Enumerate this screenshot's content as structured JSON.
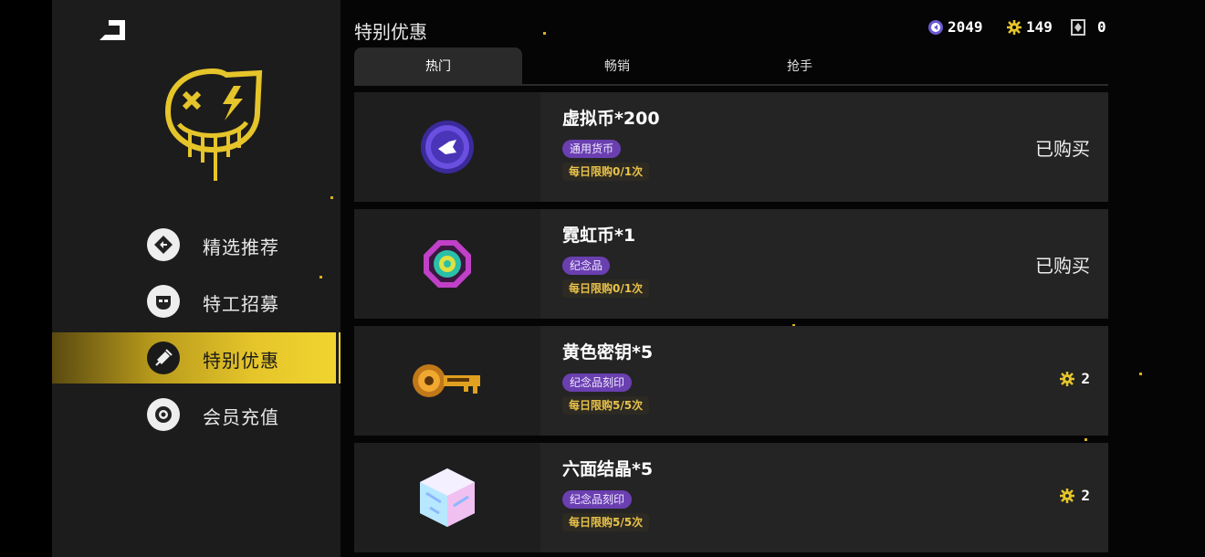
{
  "page_title": "特别优惠",
  "currencies": [
    {
      "icon": "purple-coin-icon",
      "value": "2049"
    },
    {
      "icon": "gold-gear-icon",
      "value": "149"
    },
    {
      "icon": "diamond-card-icon",
      "value": "0"
    }
  ],
  "sidebar": {
    "items": [
      {
        "label": "精选推荐",
        "icon": "diamond-arrow-icon"
      },
      {
        "label": "特工招募",
        "icon": "agent-face-icon"
      },
      {
        "label": "特别优惠",
        "icon": "special-offer-icon"
      },
      {
        "label": "会员充值",
        "icon": "target-ring-icon"
      }
    ],
    "active_index": 2
  },
  "tabs": [
    {
      "label": "热门"
    },
    {
      "label": "畅销"
    },
    {
      "label": "抢手"
    }
  ],
  "items": [
    {
      "name": "虚拟币*200",
      "tag": "通用货币",
      "limit": "每日限购0/1次",
      "status": "已购买",
      "icon": "purple-coin-icon"
    },
    {
      "name": "霓虹币*1",
      "tag": "纪念品",
      "limit": "每日限购0/1次",
      "status": "已购买",
      "icon": "neon-coin-icon"
    },
    {
      "name": "黄色密钥*5",
      "tag": "纪念品刻印",
      "limit": "每日限购5/5次",
      "price": "2",
      "price_icon": "gold-gear-icon",
      "icon": "yellow-key-icon"
    },
    {
      "name": "六面结晶*5",
      "tag": "纪念品刻印",
      "limit": "每日限购5/5次",
      "price": "2",
      "price_icon": "gold-gear-icon",
      "icon": "hex-crystal-icon"
    }
  ],
  "colors": {
    "accent_gold": "#e5c52a",
    "tag_purple": "#6a3fb0",
    "limit_text": "#e9c24a"
  }
}
